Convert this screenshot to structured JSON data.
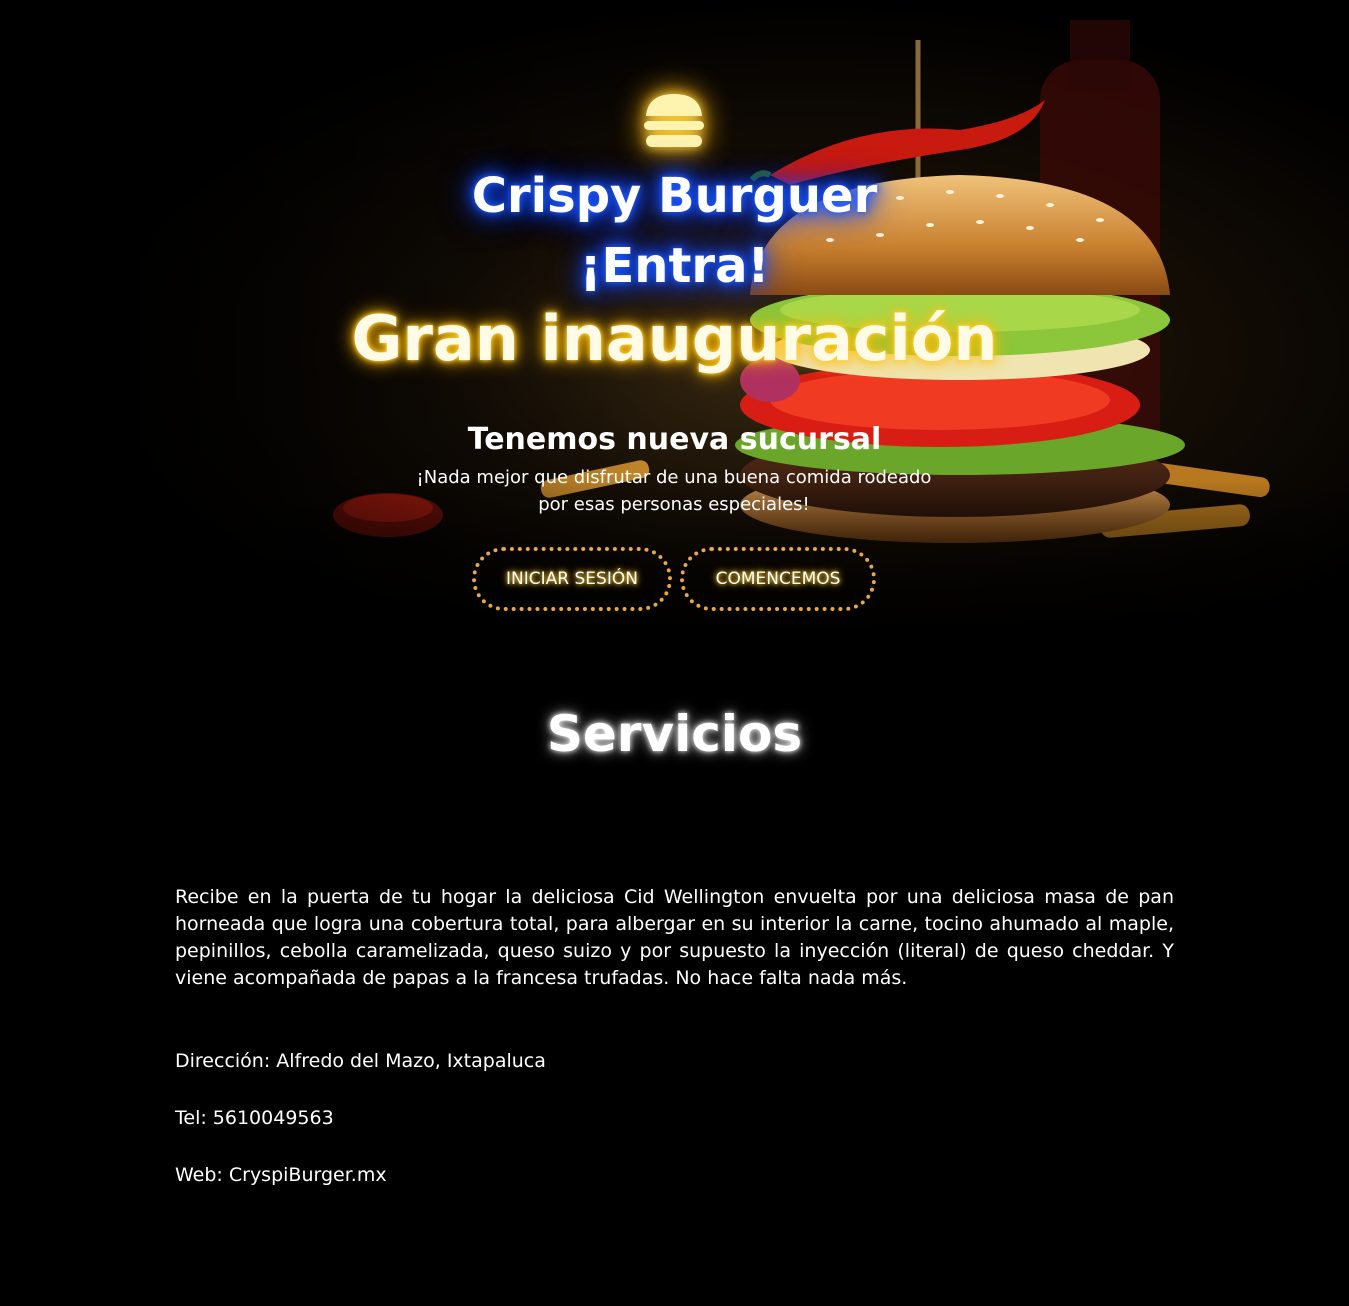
{
  "hero": {
    "brand_title": "Crispy Burguer",
    "enter_label": "¡Entra!",
    "subtitle": "Gran inauguración",
    "tagline": "Tenemos nueva sucursal",
    "description": "¡Nada mejor que disfrutar de una buena comida rodeado por esas personas especiales!",
    "buttons": {
      "login_label": "INICIAR SESIÓN",
      "start_label": "COMENCEMOS"
    },
    "logo_icon": "burger-icon",
    "image_subject": "burger with chili pepper and sauce"
  },
  "services": {
    "title": "Servicios",
    "text": "Recibe en la puerta de tu hogar la deliciosa Cid Wellington envuelta por una deliciosa masa de pan horneada que logra una cobertura total, para albergar en su interior la carne, tocino ahumado al maple, pepinillos, cebolla caramelizada, queso suizo y por supuesto la inyección (literal) de queso cheddar. Y viene acompañada de papas a la francesa trufadas. No hace falta nada más.",
    "address": "Dirección: Alfredo del Mazo, Ixtapaluca",
    "phone": "Tel: 5610049563",
    "web": "Web: CryspiBurger.mx"
  },
  "colors": {
    "background": "#000000",
    "blue_glow": "#1e5bff",
    "gold_glow": "#ffc107",
    "button_border": "#e8a74a"
  }
}
